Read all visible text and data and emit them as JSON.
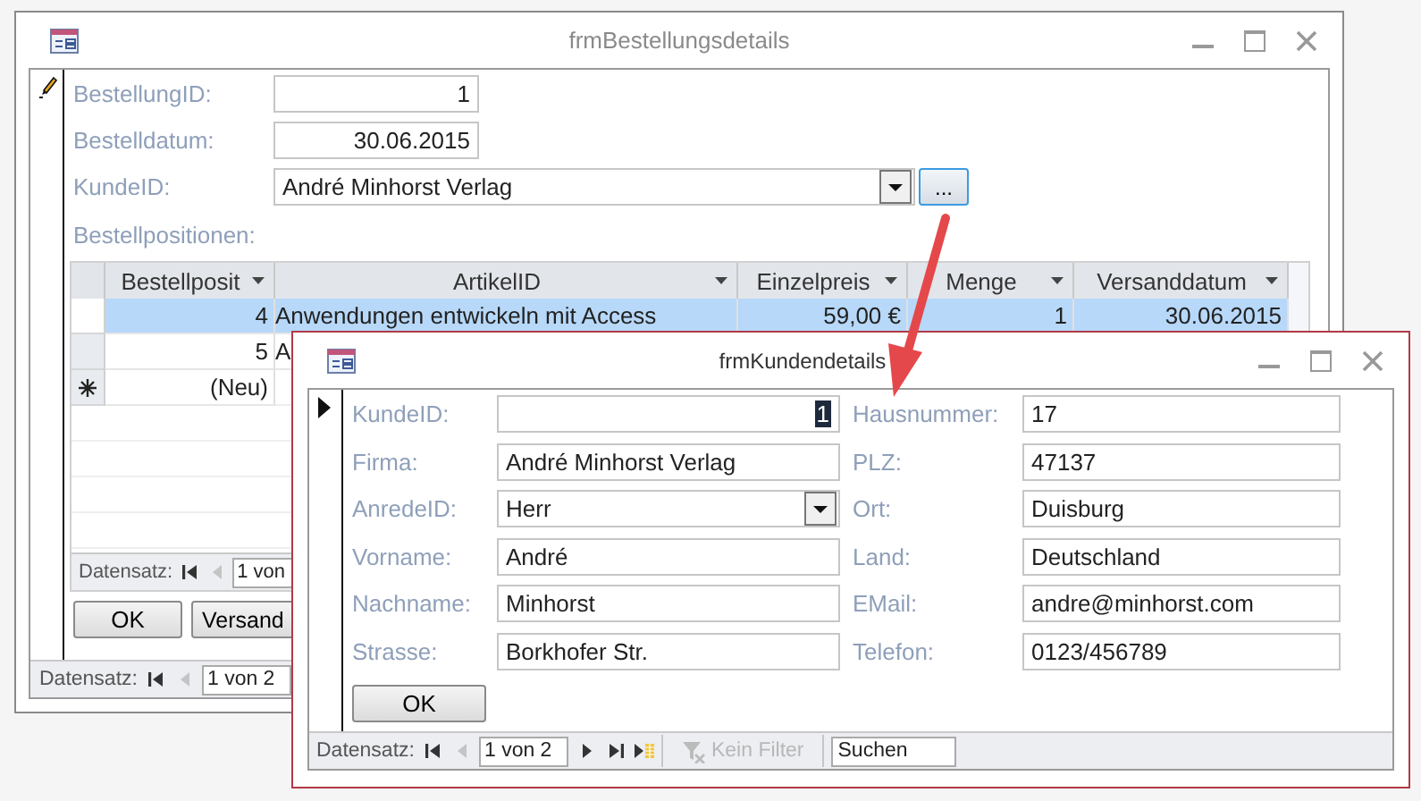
{
  "order_form": {
    "title": "frmBestellungsdetails",
    "fields": [
      {
        "label": "BestellungID:",
        "value": "1",
        "kind": "number"
      },
      {
        "label": "Bestelldatum:",
        "value": "30.06.2015",
        "kind": "number"
      },
      {
        "label": "KundeID:",
        "value": "André Minhorst Verlag",
        "kind": "combo"
      }
    ],
    "browse_button": "...",
    "subform": {
      "label": "Bestellpositionen:",
      "columns": [
        {
          "label": "Bestellposit",
          "kind": "number"
        },
        {
          "label": "ArtikelID",
          "kind": "text"
        },
        {
          "label": "Einzelpreis",
          "kind": "number"
        },
        {
          "label": "Menge",
          "kind": "number"
        },
        {
          "label": "Versanddatum",
          "kind": "number"
        }
      ],
      "rows": [
        {
          "kind": "data",
          "selected": true,
          "cells": [
            "4",
            "Anwendungen entwickeln mit Access",
            "59,00 €",
            "1",
            "30.06.2015"
          ]
        },
        {
          "kind": "data",
          "selected": false,
          "cells": [
            "5",
            "A"
          ]
        },
        {
          "kind": "new",
          "selected": false,
          "cells": [
            "(Neu)"
          ]
        }
      ],
      "nav": {
        "label": "Datensatz:",
        "position": "1 von",
        "buttons": [
          {
            "kind": "first",
            "disabled": false
          },
          {
            "kind": "prev",
            "disabled": true
          }
        ]
      }
    },
    "buttons": [
      "OK",
      "Versand"
    ],
    "nav": {
      "label": "Datensatz:",
      "position": "1 von 2",
      "buttons": [
        {
          "kind": "first",
          "disabled": false
        },
        {
          "kind": "prev",
          "disabled": true
        }
      ]
    }
  },
  "customer_form": {
    "title": "frmKundendetails",
    "fields_left": [
      {
        "label": "KundeID:",
        "value": "1",
        "kind": "number",
        "selected": true
      },
      {
        "label": "Firma:",
        "value": "André Minhorst Verlag",
        "kind": "text",
        "selected": false
      },
      {
        "label": "AnredeID:",
        "value": "Herr",
        "kind": "combo",
        "selected": false
      },
      {
        "label": "Vorname:",
        "value": "André",
        "kind": "text",
        "selected": false
      },
      {
        "label": "Nachname:",
        "value": "Minhorst",
        "kind": "text",
        "selected": false
      },
      {
        "label": "Strasse:",
        "value": "Borkhofer Str.",
        "kind": "text",
        "selected": false
      }
    ],
    "fields_right": [
      {
        "label": "Hausnummer:",
        "value": "17"
      },
      {
        "label": "PLZ:",
        "value": "47137"
      },
      {
        "label": "Ort:",
        "value": "Duisburg"
      },
      {
        "label": "Land:",
        "value": "Deutschland"
      },
      {
        "label": "EMail:",
        "value": "andre@minhorst.com"
      },
      {
        "label": "Telefon:",
        "value": "0123/456789"
      }
    ],
    "ok_button": "OK",
    "nav": {
      "label": "Datensatz:",
      "position": "1 von 2",
      "buttons": [
        {
          "kind": "first",
          "disabled": false
        },
        {
          "kind": "prev",
          "disabled": true
        },
        {
          "kind": "next",
          "disabled": false
        },
        {
          "kind": "last",
          "disabled": false
        },
        {
          "kind": "new",
          "disabled": false
        }
      ],
      "filter": {
        "label": "Kein Filter",
        "disabled": true
      },
      "search": "Suchen"
    }
  }
}
